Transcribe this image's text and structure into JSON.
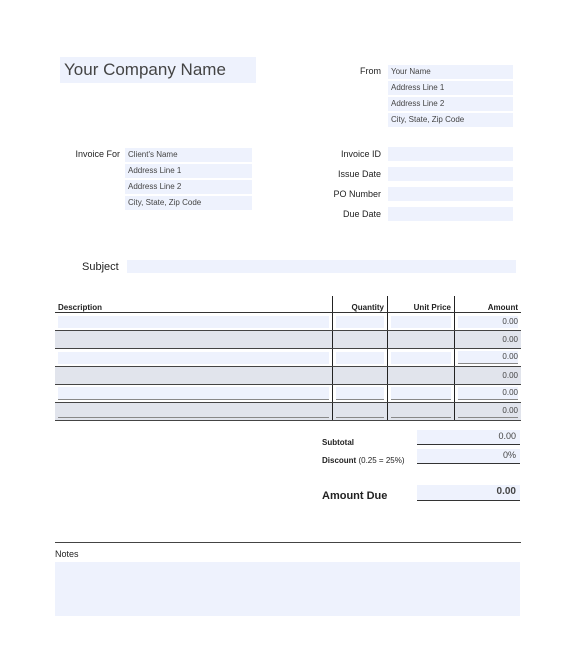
{
  "company_name": "Your Company Name",
  "from": {
    "label": "From",
    "lines": [
      "Your Name",
      "Address Line 1",
      "Address Line 2",
      "City, State, Zip Code"
    ]
  },
  "invoice_for": {
    "label": "Invoice For",
    "lines": [
      "Client's Name",
      "Address Line 1",
      "Address Line 2",
      "City, State, Zip Code"
    ]
  },
  "meta": {
    "invoice_id_label": "Invoice ID",
    "invoice_id_value": "",
    "issue_date_label": "Issue Date",
    "issue_date_value": "",
    "po_number_label": "PO Number",
    "po_number_value": "",
    "due_date_label": "Due Date",
    "due_date_value": ""
  },
  "subject": {
    "label": "Subject",
    "value": ""
  },
  "table": {
    "headers": [
      "Description",
      "Quantity",
      "Unit Price",
      "Amount"
    ],
    "rows": [
      {
        "description": "",
        "quantity": "",
        "unit_price": "",
        "amount": "0.00"
      },
      {
        "description": "",
        "quantity": "",
        "unit_price": "",
        "amount": "0.00"
      },
      {
        "description": "",
        "quantity": "",
        "unit_price": "",
        "amount": "0.00"
      },
      {
        "description": "",
        "quantity": "",
        "unit_price": "",
        "amount": "0.00"
      },
      {
        "description": "",
        "quantity": "",
        "unit_price": "",
        "amount": "0.00"
      },
      {
        "description": "",
        "quantity": "",
        "unit_price": "",
        "amount": "0.00"
      }
    ]
  },
  "totals": {
    "subtotal_label": "Subtotal",
    "subtotal_value": "0.00",
    "discount_label": "Discount",
    "discount_hint": "(0.25 = 25%)",
    "discount_value": "0%",
    "amount_due_label": "Amount Due",
    "amount_due_value": "0.00"
  },
  "notes": {
    "label": "Notes",
    "value": ""
  },
  "colors": {
    "field_bg": "#eef2fd",
    "row_shade": "#e1e4ec"
  }
}
